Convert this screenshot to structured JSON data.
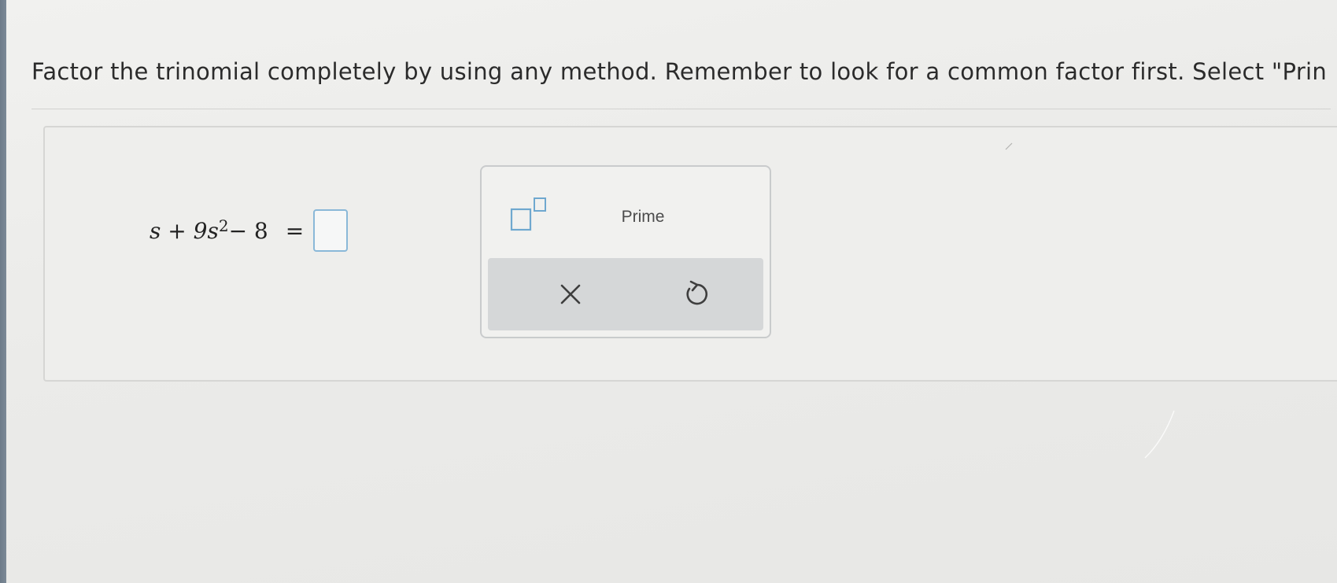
{
  "question": {
    "instruction": "Factor the trinomial completely by using any method. Remember to look for a common factor first. Select \"Prin",
    "equation": {
      "lhs_prefix": "s + 9s",
      "exponent": "2",
      "lhs_suffix": " − 8",
      "equals": "="
    },
    "answer_value": ""
  },
  "palette": {
    "buttons": [
      {
        "name": "exponent-template",
        "icon": "superscript-template-icon"
      },
      {
        "name": "prime",
        "label": "Prime"
      }
    ],
    "actions": [
      {
        "name": "clear",
        "icon": "close-icon"
      },
      {
        "name": "undo",
        "icon": "undo-icon"
      }
    ]
  },
  "colors": {
    "answer_border": "#8ab8d8",
    "template_box": "#6fa8cf",
    "action_bar": "#d5d7d8"
  }
}
